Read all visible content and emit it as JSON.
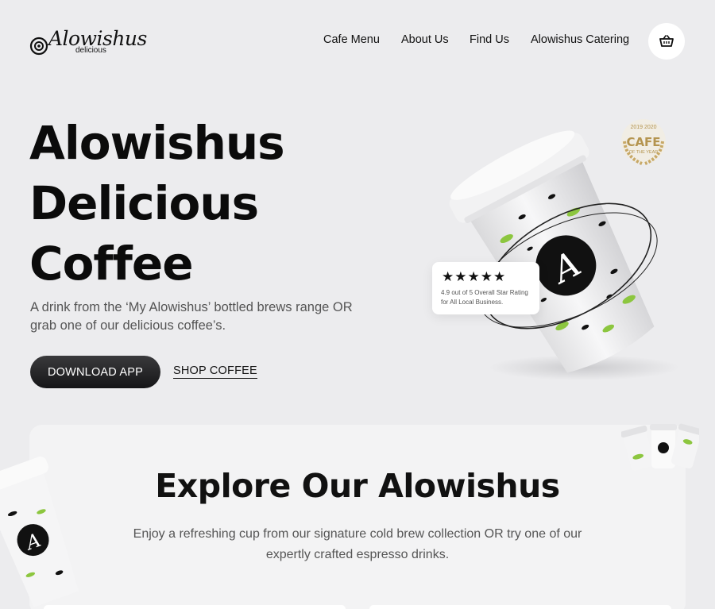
{
  "brand": {
    "logo_script": "Alowishus",
    "logo_sub": "delicious"
  },
  "nav": {
    "items": [
      {
        "label": "Cafe Menu"
      },
      {
        "label": "About Us"
      },
      {
        "label": "Find Us"
      },
      {
        "label": "Alowishus Catering"
      }
    ],
    "cart_icon": "basket-icon"
  },
  "hero": {
    "title_line1": "Alowishus",
    "title_line2": "Delicious",
    "title_line3": "Coffee",
    "subtitle": "A drink from the ‘My Alowishus’ bottled brews range OR grab one of our delicious coffee’s.",
    "download_label": "DOWNLOAD APP",
    "shop_label": "SHOP COFFEE"
  },
  "rating": {
    "stars": "★★★★★",
    "stars_count": 5,
    "text": "4.9 out of 5 Overall Star Rating for All Local Business."
  },
  "badge": {
    "years": "2019 2020",
    "word": "CAFE",
    "sub": "OF THE YEAR"
  },
  "cup_logo": "A",
  "explore": {
    "title": "Explore Our Alowishus",
    "subtitle": "Enjoy a refreshing cup from our signature cold brew collection OR try one of our expertly crafted espresso drinks."
  },
  "colors": {
    "background": "#ececee",
    "text": "#111111",
    "button_dark": "#1f1f21",
    "leaf_green": "#8cc63f"
  }
}
